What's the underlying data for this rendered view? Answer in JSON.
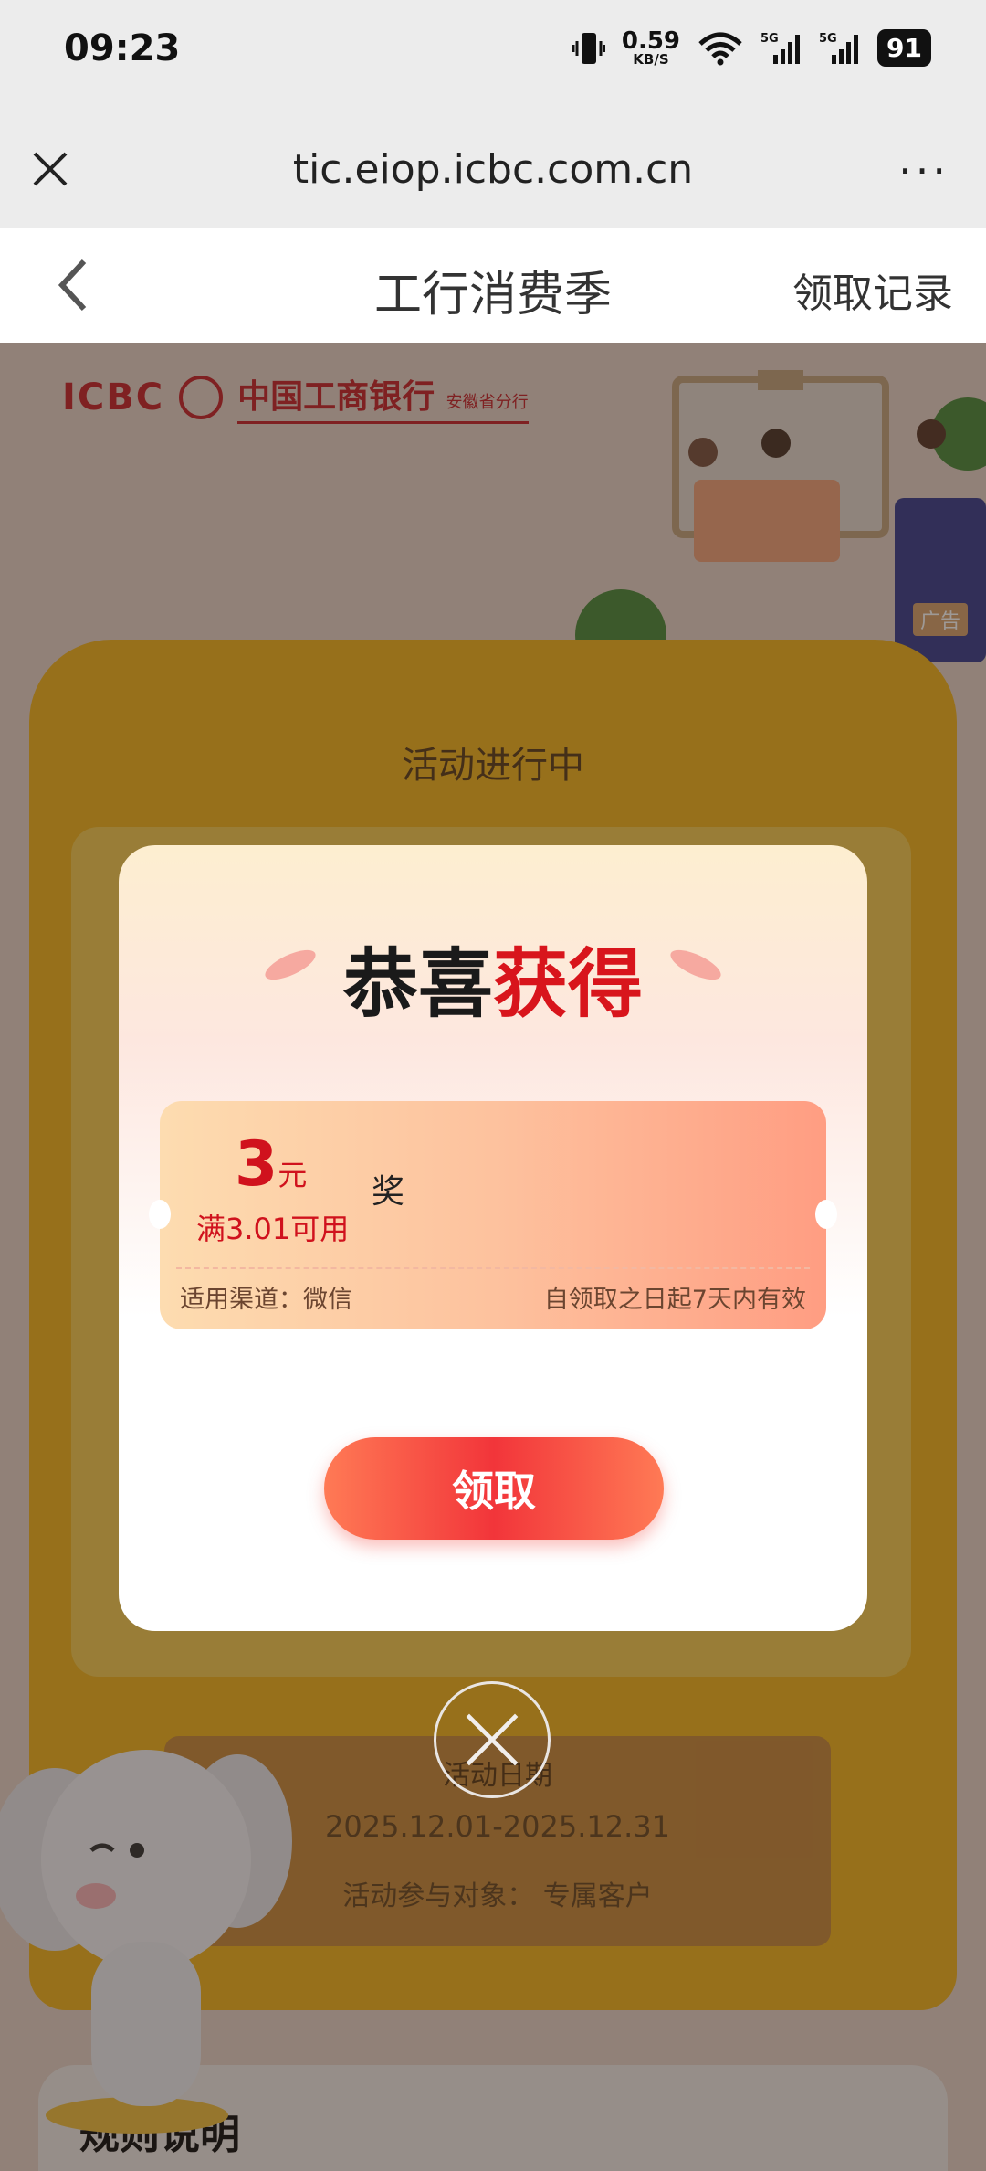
{
  "status_bar": {
    "time": "09:23",
    "net_speed_value": "0.59",
    "net_speed_unit": "KB/S",
    "signal_1_label": "5G",
    "signal_2_label": "5G",
    "battery": "91"
  },
  "browser": {
    "url": "tic.eiop.icbc.com.cn",
    "more_label": "···"
  },
  "header": {
    "title": "工行消费季",
    "records_label": "领取记录"
  },
  "background_page": {
    "bank_abbr": "ICBC",
    "bank_name": "中国工商银行",
    "bank_branch": "安徽省分行",
    "ad_tag": "广告",
    "activity_status": "活动进行中",
    "date_label": "活动日期",
    "date_range": "2025.12.01-2025.12.31",
    "participant": "活动参与对象：  专属客户",
    "rules_title": "规则说明"
  },
  "modal": {
    "title_dark": "恭喜",
    "title_red": "获得",
    "coupon": {
      "amount": "3",
      "unit": "元",
      "condition": "满3.01可用",
      "prize_label": "奖",
      "channel": "适用渠道：微信",
      "validity": "自领取之日起7天内有效"
    },
    "claim_button": "领取"
  },
  "colors": {
    "brand_red": "#d8151c",
    "button_red": "#f2353a",
    "frame_yellow": "#f2b51f"
  },
  "icons": [
    "vibrate-icon",
    "wifi-icon",
    "signal-icon",
    "close-icon",
    "more-icon",
    "back-icon",
    "modal-close-icon",
    "mascot-elephant"
  ]
}
